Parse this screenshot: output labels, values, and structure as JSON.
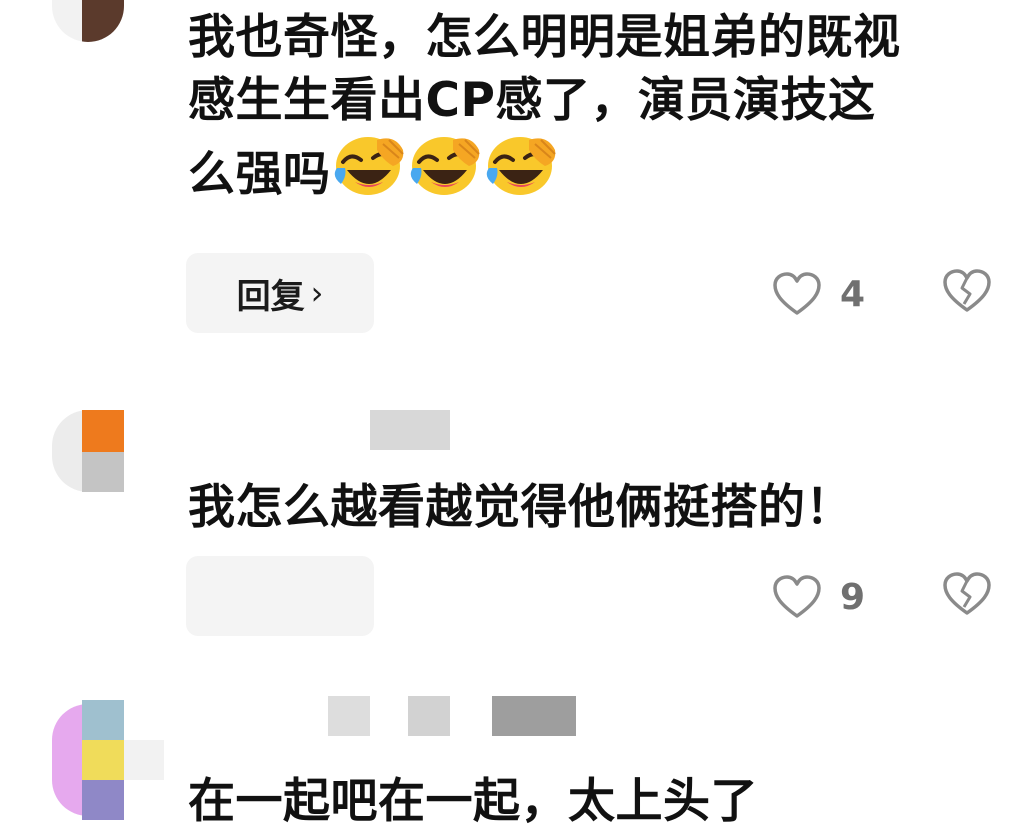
{
  "colors": {
    "text": "#111111",
    "count": "#707070",
    "icon": "#8a8a8a",
    "chip_bg": "#f4f4f4",
    "redaction": "#d6d6d6"
  },
  "comments": [
    {
      "text_lines": [
        "我也奇怪，怎么明明是姐弟的既视",
        "感生生看出CP感了，演员演技这",
        "么强吗"
      ],
      "emoji": [
        "face-with-tears-of-joy",
        "face-with-tears-of-joy",
        "face-with-tears-of-joy"
      ],
      "reply_label": "回复",
      "reply_chevron": "›",
      "likes": "4"
    },
    {
      "text": "我怎么越看越觉得他俩挺搭的！",
      "likes": "9"
    },
    {
      "text": "在一起吧在一起，太上头了"
    }
  ]
}
